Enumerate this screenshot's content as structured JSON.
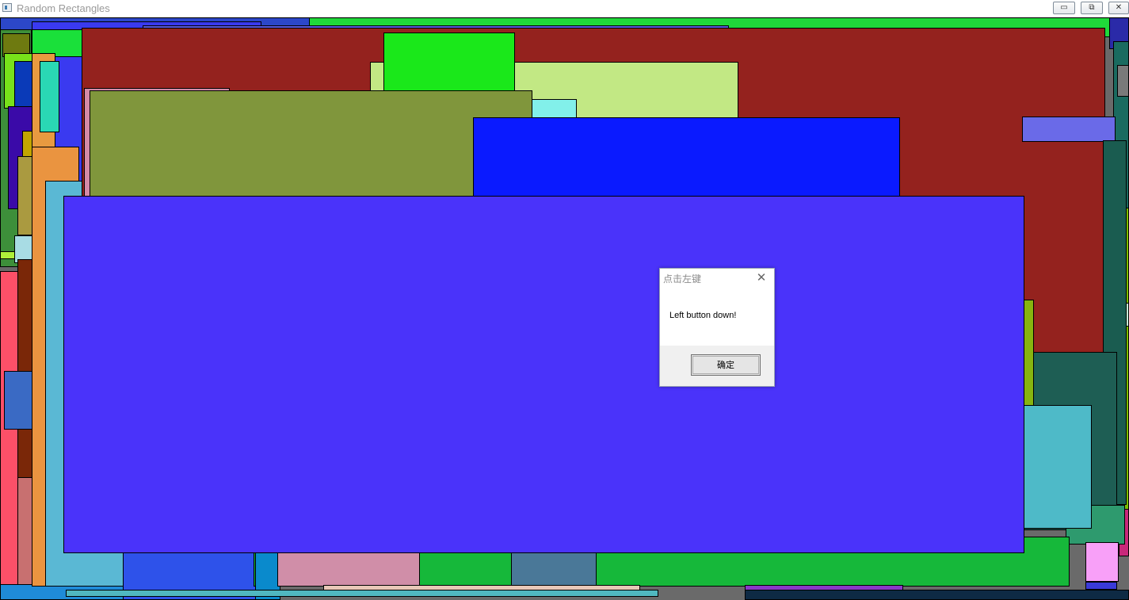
{
  "window": {
    "title": "Random Rectangles",
    "minimize_label": "▭",
    "maximize_label": "⧉",
    "close_label": "✕"
  },
  "dialog": {
    "title": "点击左键",
    "close_icon": "✕",
    "message": "Left button down!",
    "ok_label": "确定"
  },
  "colors": {
    "canvas_foreground": "#4a33fa",
    "dialog_footer": "#f0f0f0"
  }
}
